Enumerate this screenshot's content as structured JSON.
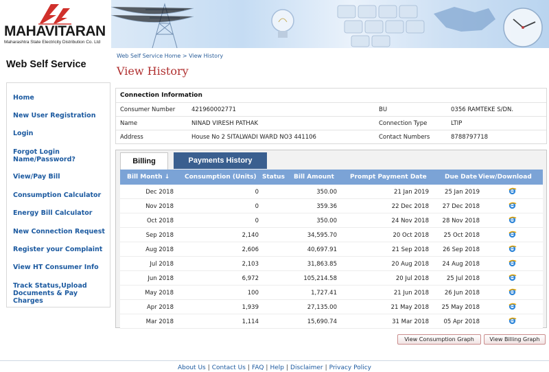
{
  "brand": {
    "name_prefix": "MAHA",
    "name_suffix": "VITARAN",
    "subtitle": "Maharashtra State Electricity Distribution Co. Ltd"
  },
  "app_title": "Web Self Service",
  "sidebar": {
    "items": [
      {
        "label": "Home"
      },
      {
        "label": "New User Registration"
      },
      {
        "label": "Login"
      },
      {
        "label": "Forgot Login\nName/Password?"
      },
      {
        "label": "View/Pay Bill"
      },
      {
        "label": "Consumption Calculator"
      },
      {
        "label": "Energy Bill Calculator"
      },
      {
        "label": "New Connection Request"
      },
      {
        "label": "Register your Complaint"
      },
      {
        "label": "View HT Consumer Info"
      },
      {
        "label": "Track Status,Upload\nDocuments & Pay Charges"
      }
    ]
  },
  "breadcrumb": {
    "home": "Web Self Service Home",
    "separator": ">",
    "current": "View History"
  },
  "page_title": "View History",
  "connection": {
    "heading": "Connection Information",
    "rows": [
      {
        "l1": "Consumer Number",
        "v1": "421960002771",
        "l2": "BU",
        "v2": "0356 RAMTEKE S/DN."
      },
      {
        "l1": "Name",
        "v1": "NINAD VIRESH PATHAK",
        "l2": "Connection Type",
        "v2": "LTIP"
      },
      {
        "l1": "Address",
        "v1": "House No 2 SITALWADI WARD NO3 441106",
        "l2": "Contact Numbers",
        "v2": "8788797718"
      }
    ]
  },
  "tabs": {
    "billing": "Billing",
    "payments": "Payments History"
  },
  "table": {
    "headers": {
      "bill_month": "Bill Month ↓",
      "consumption": "Consumption (Units)",
      "status": "Status",
      "bill_amount": "Bill Amount",
      "prompt_date": "Prompt Payment Date",
      "due_date": "Due Date",
      "view": "View/Download"
    },
    "rows": [
      {
        "month": "Dec 2018",
        "units": "0",
        "status": "",
        "amount": "350.00",
        "prompt": "21 Jan 2019",
        "due": "25 Jan 2019"
      },
      {
        "month": "Nov 2018",
        "units": "0",
        "status": "",
        "amount": "359.36",
        "prompt": "22 Dec 2018",
        "due": "27 Dec 2018"
      },
      {
        "month": "Oct 2018",
        "units": "0",
        "status": "",
        "amount": "350.00",
        "prompt": "24 Nov 2018",
        "due": "28 Nov 2018"
      },
      {
        "month": "Sep 2018",
        "units": "2,140",
        "status": "",
        "amount": "34,595.70",
        "prompt": "20 Oct 2018",
        "due": "25 Oct 2018"
      },
      {
        "month": "Aug 2018",
        "units": "2,606",
        "status": "",
        "amount": "40,697.91",
        "prompt": "21 Sep 2018",
        "due": "26 Sep 2018"
      },
      {
        "month": "Jul 2018",
        "units": "2,103",
        "status": "",
        "amount": "31,863.85",
        "prompt": "20 Aug 2018",
        "due": "24 Aug 2018"
      },
      {
        "month": "Jun 2018",
        "units": "6,972",
        "status": "",
        "amount": "105,214.58",
        "prompt": "20 Jul 2018",
        "due": "25 Jul 2018"
      },
      {
        "month": "May 2018",
        "units": "100",
        "status": "",
        "amount": "1,727.41",
        "prompt": "21 Jun 2018",
        "due": "26 Jun 2018"
      },
      {
        "month": "Apr 2018",
        "units": "1,939",
        "status": "",
        "amount": "27,135.00",
        "prompt": "21 May 2018",
        "due": "25 May 2018"
      },
      {
        "month": "Mar 2018",
        "units": "1,114",
        "status": "",
        "amount": "15,690.74",
        "prompt": "31 Mar 2018",
        "due": "05 Apr 2018"
      }
    ]
  },
  "buttons": {
    "consumption_graph": "View Consumption Graph",
    "billing_graph": "View Billing Graph"
  },
  "footer": {
    "links": [
      "About Us",
      "Contact Us",
      "FAQ",
      "Help",
      "Disclaimer",
      "Privacy Policy"
    ],
    "separator": "|"
  },
  "colors": {
    "brand_red": "#d0302b",
    "link_blue": "#1c5aa0",
    "title_red": "#b03030",
    "table_header": "#7ba3d6",
    "active_tab_bg": "#3a5f8f"
  }
}
